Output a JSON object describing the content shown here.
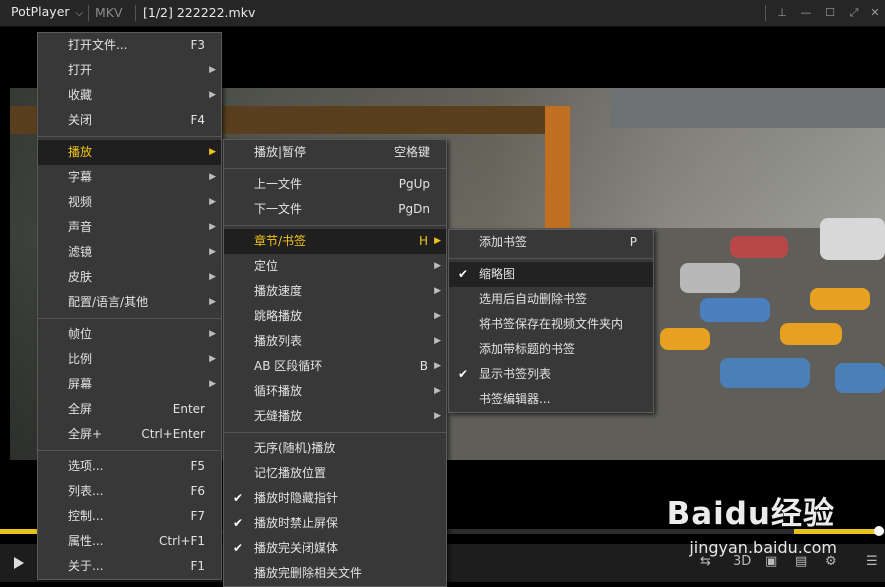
{
  "titlebar": {
    "app_name": "PotPlayer",
    "format": "MKV",
    "file": "[1/2] 222222.mkv"
  },
  "main_menu": [
    {
      "label": "打开文件...",
      "shortcut": "F3"
    },
    {
      "label": "打开",
      "submenu": true
    },
    {
      "label": "收藏",
      "submenu": true
    },
    {
      "label": "关闭",
      "shortcut": "F4"
    },
    {
      "sep": true
    },
    {
      "label": "播放",
      "submenu": true,
      "active": true
    },
    {
      "label": "字幕",
      "submenu": true
    },
    {
      "label": "视频",
      "submenu": true
    },
    {
      "label": "声音",
      "submenu": true
    },
    {
      "label": "滤镜",
      "submenu": true
    },
    {
      "label": "皮肤",
      "submenu": true
    },
    {
      "label": "配置/语言/其他",
      "submenu": true
    },
    {
      "sep": true
    },
    {
      "label": "帧位",
      "submenu": true
    },
    {
      "label": "比例",
      "submenu": true
    },
    {
      "label": "屏幕",
      "submenu": true
    },
    {
      "label": "全屏",
      "shortcut": "Enter"
    },
    {
      "label": "全屏+",
      "shortcut": "Ctrl+Enter"
    },
    {
      "sep": true
    },
    {
      "label": "选项...",
      "shortcut": "F5"
    },
    {
      "label": "列表...",
      "shortcut": "F6"
    },
    {
      "label": "控制...",
      "shortcut": "F7"
    },
    {
      "label": "属性...",
      "shortcut": "Ctrl+F1"
    },
    {
      "label": "关于...",
      "shortcut": "F1"
    }
  ],
  "play_menu": [
    {
      "label": "播放|暂停",
      "shortcut": "空格键"
    },
    {
      "sep": true
    },
    {
      "label": "上一文件",
      "shortcut": "PgUp"
    },
    {
      "label": "下一文件",
      "shortcut": "PgDn"
    },
    {
      "sep": true
    },
    {
      "label": "章节/书签",
      "shortcut": "H",
      "submenu": true,
      "active": true
    },
    {
      "label": "定位",
      "submenu": true
    },
    {
      "label": "播放速度",
      "submenu": true
    },
    {
      "label": "跳略播放",
      "submenu": true
    },
    {
      "label": "播放列表",
      "submenu": true
    },
    {
      "label": "AB 区段循环",
      "shortcut": "B",
      "submenu": true
    },
    {
      "label": "循环播放",
      "submenu": true
    },
    {
      "label": "无缝播放",
      "submenu": true
    },
    {
      "sep": true
    },
    {
      "label": "无序(随机)播放"
    },
    {
      "label": "记忆播放位置"
    },
    {
      "label": "播放时隐藏指针",
      "checked": true
    },
    {
      "label": "播放时禁止屏保",
      "checked": true
    },
    {
      "label": "播放完关闭媒体",
      "checked": true
    },
    {
      "label": "播放完删除相关文件"
    }
  ],
  "chapter_menu": [
    {
      "label": "添加书签",
      "shortcut": "P"
    },
    {
      "sep": true
    },
    {
      "label": "缩略图",
      "checked": true,
      "highlighted": true
    },
    {
      "label": "选用后自动删除书签"
    },
    {
      "label": "将书签保存在视频文件夹内"
    },
    {
      "label": "添加带标题的书签"
    },
    {
      "label": "显示书签列表",
      "checked": true
    },
    {
      "label": "书签编辑器..."
    }
  ],
  "watermark": {
    "brand": "Baidu经验",
    "url": "jingyan.baidu.com"
  },
  "icons": {
    "play": "play-icon",
    "menu": "hamburger-icon",
    "settings": "gear-icon"
  },
  "colors": {
    "accent": "#f0c419",
    "menu_bg": "#383838"
  }
}
